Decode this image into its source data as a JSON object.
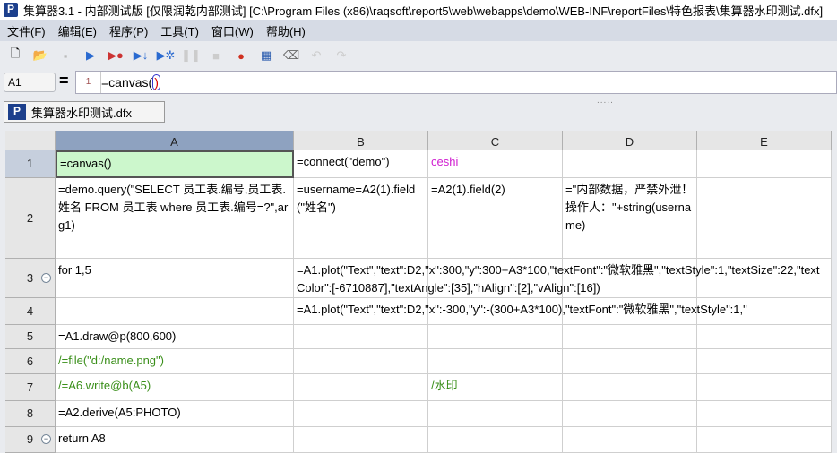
{
  "title": "集算器3.1 - 内部测试版 [仅限润乾内部测试]  [C:\\Program Files (x86)\\raqsoft\\report5\\web\\webapps\\demo\\WEB-INF\\reportFiles\\特色报表\\集算器水印测试.dfx]",
  "logo_letter": "P",
  "menu": [
    "文件(F)",
    "编辑(E)",
    "程序(P)",
    "工具(T)",
    "窗口(W)",
    "帮助(H)"
  ],
  "formula": {
    "cell": "A1",
    "eq": "=",
    "line": "1",
    "text": "=canvas(",
    "paren": ")"
  },
  "tab": {
    "label": "集算器水印测试.dfx",
    "grip": "....."
  },
  "columns": [
    "A",
    "B",
    "C",
    "D",
    "E"
  ],
  "rows": [
    "1",
    "2",
    "3",
    "4",
    "5",
    "6",
    "7",
    "8",
    "9"
  ],
  "cells": {
    "A1": "=canvas()",
    "B1": "=connect(\"demo\")",
    "C1": "ceshi",
    "A2": "=demo.query(\"SELECT 员工表.编号,员工表.姓名 FROM 员工表 where 员工表.编号=?\",arg1)",
    "B2": "=username=A2(1).field(\"姓名\")",
    "C2": "=A2(1).field(2)",
    "D2": "=\"内部数据，严禁外泄！操作人：\"+string(username)",
    "A3": "for 1,5",
    "B3": "=A1.plot(\"Text\",\"text\":D2,\"x\":300,\"y\":300+A3*100,\"textFont\":\"微软雅黑\",\"textStyle\":1,\"textSize\":22,\"textColor\":[-6710887],\"textAngle\":[35],\"hAlign\":[2],\"vAlign\":[16])",
    "B4": "=A1.plot(\"Text\",\"text\":D2,\"x\":-300,\"y\":-(300+A3*100),\"textFont\":\"微软雅黑\",\"textStyle\":1,\"",
    "A5": "=A1.draw@p(800,600)",
    "A6": "/=file(\"d:/name.png\")",
    "A7": "/=A6.write@b(A5)",
    "C7": "/水印",
    "A8": "=A2.derive(A5:PHOTO)",
    "A9": "return A8"
  }
}
